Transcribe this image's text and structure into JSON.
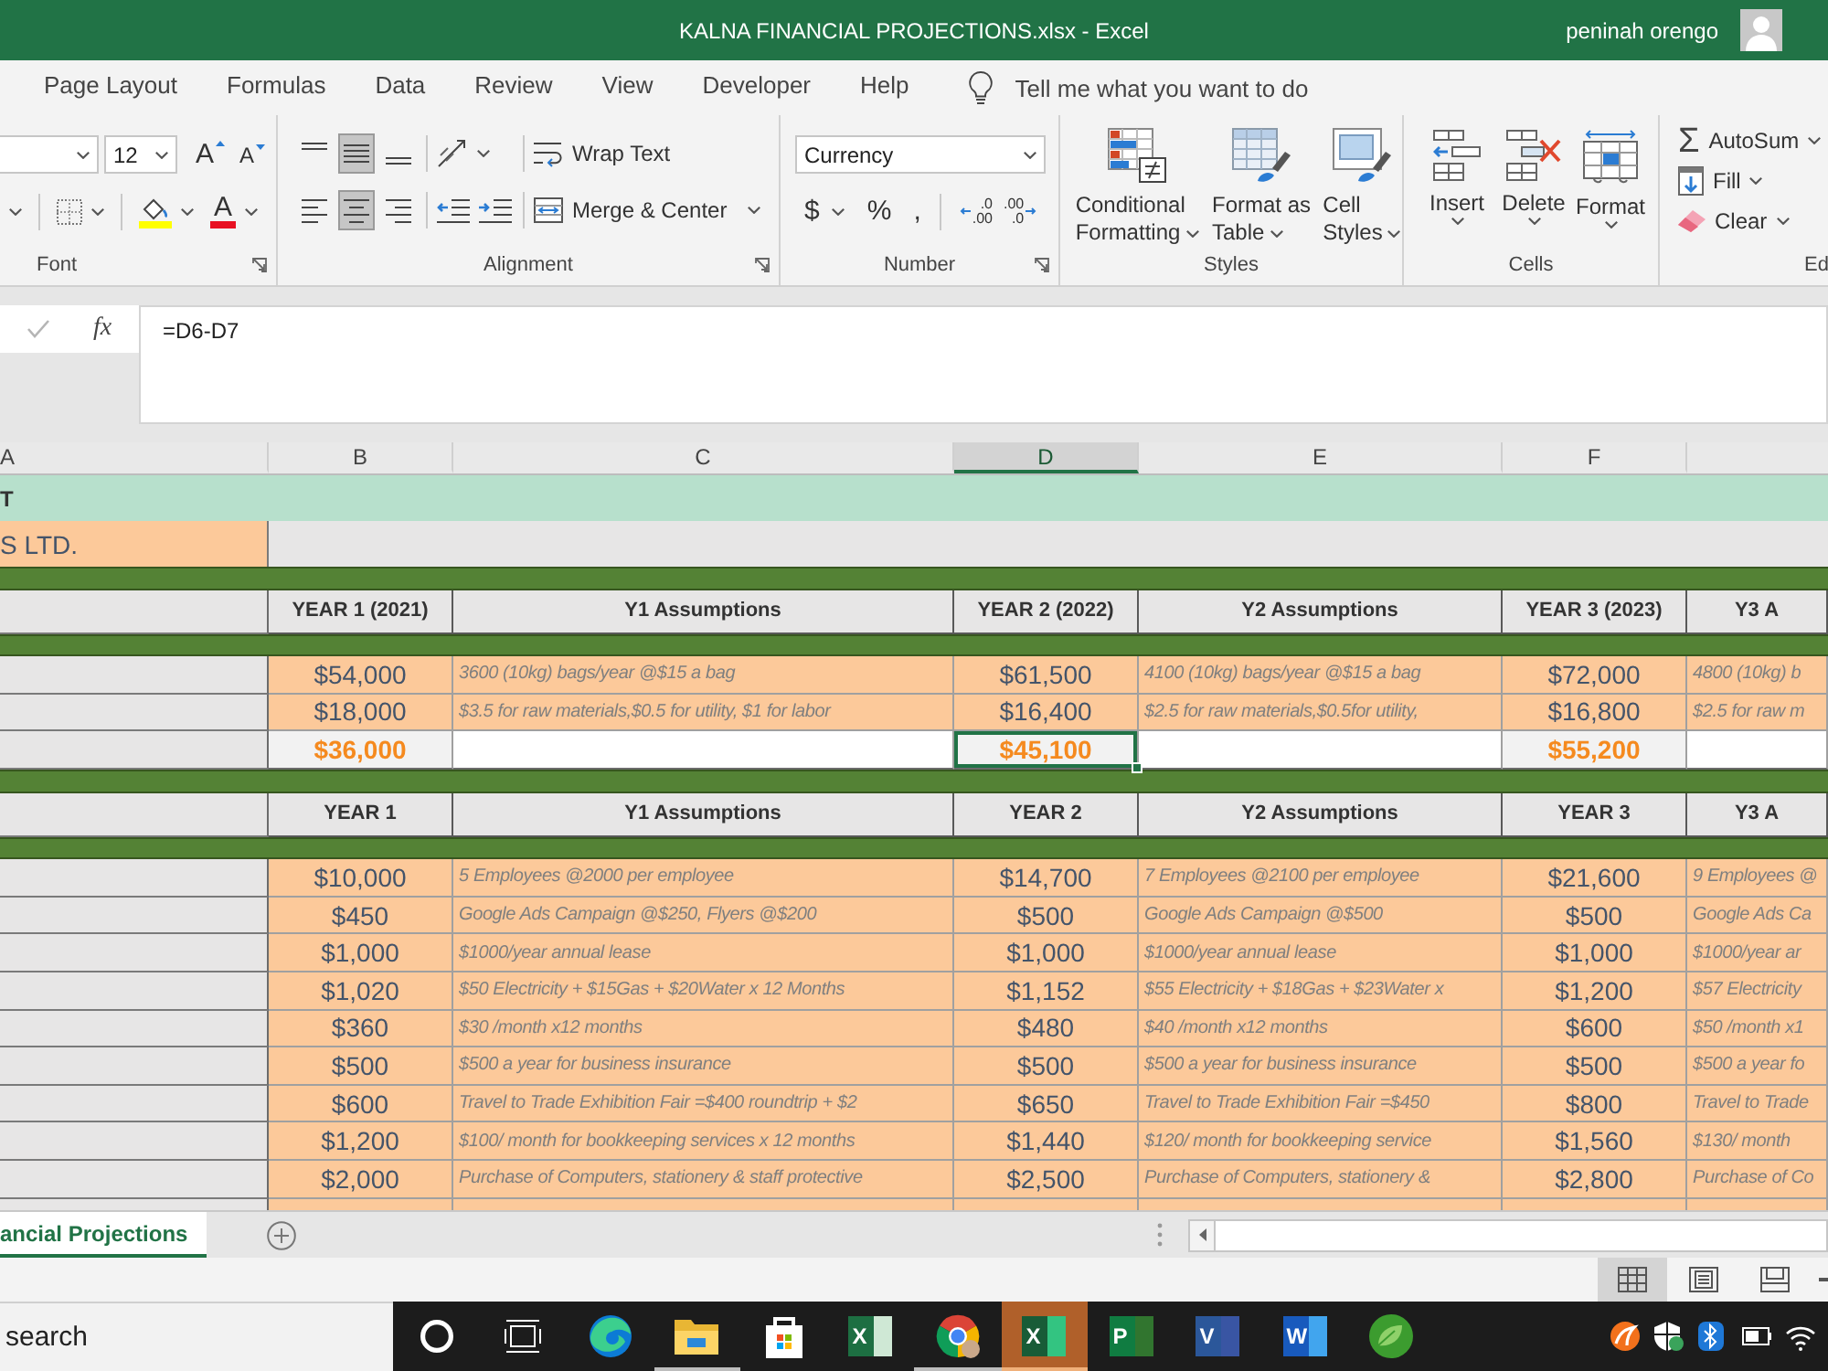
{
  "window": {
    "title": "KALNA FINANCIAL PROJECTIONS.xlsx - Excel",
    "user": "peninah orengo"
  },
  "menu": {
    "tabs": [
      {
        "label": "Page Layout",
        "selected": false
      },
      {
        "label": "Formulas",
        "selected": false
      },
      {
        "label": "Data",
        "selected": false
      },
      {
        "label": "Review",
        "selected": false
      },
      {
        "label": "View",
        "selected": false
      },
      {
        "label": "Developer",
        "selected": false
      },
      {
        "label": "Help",
        "selected": false
      }
    ],
    "tell_me": "Tell me what you want to do"
  },
  "ribbon": {
    "font": {
      "label": "Font",
      "size": "12",
      "grow": "A",
      "shrink": "A",
      "font_color": "A"
    },
    "alignment": {
      "label": "Alignment",
      "vertical": [
        {
          "kind": "top",
          "selected": false
        },
        {
          "kind": "middle",
          "selected": true
        },
        {
          "kind": "bottom",
          "selected": false
        }
      ],
      "horizontal": [
        {
          "kind": "left",
          "selected": false
        },
        {
          "kind": "center",
          "selected": true
        },
        {
          "kind": "right",
          "selected": false
        }
      ],
      "wrap_text": "Wrap Text",
      "merge": "Merge & Center"
    },
    "number": {
      "label": "Number",
      "format": "Currency",
      "symbols": [
        {
          "kind": "currency",
          "text": "$"
        },
        {
          "kind": "percent",
          "text": "%"
        },
        {
          "kind": "comma",
          "text": ","
        }
      ],
      "decimals": [
        {
          "kind": "increase",
          "lines": [
            ".0",
            ".00"
          ]
        },
        {
          "kind": "decrease",
          "lines": [
            ".00",
            ".0"
          ]
        }
      ]
    },
    "styles": {
      "label": "Styles",
      "buttons": [
        {
          "kind": "conditional",
          "lines": [
            "Conditional",
            "Formatting"
          ]
        },
        {
          "kind": "table",
          "lines": [
            "Format as",
            "Table"
          ]
        },
        {
          "kind": "cell",
          "lines": [
            "Cell",
            "Styles"
          ]
        }
      ]
    },
    "cells": {
      "label": "Cells",
      "buttons": [
        {
          "kind": "insert",
          "label": "Insert"
        },
        {
          "kind": "delete",
          "label": "Delete"
        },
        {
          "kind": "format",
          "label": "Format"
        }
      ]
    },
    "editing": {
      "label": "Ed",
      "buttons": [
        {
          "kind": "autosum",
          "symbol": "Σ",
          "label": "AutoSum"
        },
        {
          "kind": "fill",
          "label": "Fill"
        },
        {
          "kind": "clear",
          "label": "Clear"
        }
      ]
    }
  },
  "formula_bar": {
    "function_label": "fx",
    "formula": "=D6-D7"
  },
  "sheet": {
    "columns": [
      {
        "label": "A",
        "selected": false
      },
      {
        "label": "B",
        "selected": false
      },
      {
        "label": "C",
        "selected": false
      },
      {
        "label": "D",
        "selected": true
      },
      {
        "label": "E",
        "selected": false
      },
      {
        "label": "F",
        "selected": false
      }
    ],
    "rows": [
      {
        "kind": "title",
        "text": "T"
      },
      {
        "kind": "company",
        "text": "S LTD."
      },
      {
        "kind": "band"
      },
      {
        "kind": "header",
        "years": [
          {
            "amount": "YEAR 1 (2021)",
            "note": "Y1 Assumptions"
          },
          {
            "amount": "YEAR 2 (2022)",
            "note": "Y2 Assumptions"
          },
          {
            "amount": "YEAR 3 (2023)",
            "note": "Y3 A"
          }
        ]
      },
      {
        "kind": "band"
      },
      {
        "kind": "value",
        "years": [
          {
            "amount": "$54,000",
            "note": "3600 (10kg) bags/year @$15 a bag",
            "selected": false
          },
          {
            "amount": "$61,500",
            "note": "4100 (10kg) bags/year @$15 a bag",
            "selected": false
          },
          {
            "amount": "$72,000",
            "note": "4800 (10kg) b",
            "selected": false
          }
        ]
      },
      {
        "kind": "value",
        "years": [
          {
            "amount": "$18,000",
            "note": "$3.5 for raw materials,$0.5 for utility, $1 for labor",
            "selected": false
          },
          {
            "amount": "$16,400",
            "note": "$2.5 for raw materials,$0.5for utility,",
            "selected": false
          },
          {
            "amount": "$16,800",
            "note": "$2.5 for raw m",
            "selected": false
          }
        ]
      },
      {
        "kind": "total",
        "years": [
          {
            "amount": "$36,000",
            "selected": false
          },
          {
            "amount": "$45,100",
            "selected": true
          },
          {
            "amount": "$55,200",
            "selected": false
          }
        ]
      },
      {
        "kind": "band"
      },
      {
        "kind": "header",
        "years": [
          {
            "amount": "YEAR 1",
            "note": "Y1 Assumptions"
          },
          {
            "amount": "YEAR 2",
            "note": "Y2 Assumptions"
          },
          {
            "amount": "YEAR 3",
            "note": "Y3 A"
          }
        ]
      },
      {
        "kind": "band"
      },
      {
        "kind": "value",
        "years": [
          {
            "amount": "$10,000",
            "note": "5 Employees @2000 per employee",
            "selected": false
          },
          {
            "amount": "$14,700",
            "note": "7 Employees @2100 per employee",
            "selected": false
          },
          {
            "amount": "$21,600",
            "note": "9 Employees @",
            "selected": false
          }
        ]
      },
      {
        "kind": "value",
        "years": [
          {
            "amount": "$450",
            "note": "Google Ads Campaign @$250, Flyers @$200",
            "selected": false
          },
          {
            "amount": "$500",
            "note": "Google Ads Campaign @$500",
            "selected": false
          },
          {
            "amount": "$500",
            "note": "Google Ads Ca",
            "selected": false
          }
        ]
      },
      {
        "kind": "value",
        "years": [
          {
            "amount": "$1,000",
            "note": "$1000/year annual lease",
            "selected": false
          },
          {
            "amount": "$1,000",
            "note": "$1000/year annual lease",
            "selected": false
          },
          {
            "amount": "$1,000",
            "note": "$1000/year ar",
            "selected": false
          }
        ]
      },
      {
        "kind": "value",
        "years": [
          {
            "amount": "$1,020",
            "note": "$50 Electricity + $15Gas + $20Water x 12 Months",
            "selected": false
          },
          {
            "amount": "$1,152",
            "note": "$55 Electricity + $18Gas + $23Water x",
            "selected": false
          },
          {
            "amount": "$1,200",
            "note": "$57 Electricity",
            "selected": false
          }
        ]
      },
      {
        "kind": "value",
        "years": [
          {
            "amount": "$360",
            "note": "$30 /month x12 months",
            "selected": false
          },
          {
            "amount": "$480",
            "note": "$40 /month x12 months",
            "selected": false
          },
          {
            "amount": "$600",
            "note": "$50 /month x1",
            "selected": false
          }
        ]
      },
      {
        "kind": "value",
        "years": [
          {
            "amount": "$500",
            "note": "$500 a year for business insurance",
            "selected": false
          },
          {
            "amount": "$500",
            "note": "$500 a year for business insurance",
            "selected": false
          },
          {
            "amount": "$500",
            "note": "$500 a year fo",
            "selected": false
          }
        ]
      },
      {
        "kind": "value",
        "years": [
          {
            "amount": "$600",
            "note": "Travel to Trade Exhibition Fair =$400 roundtrip + $2",
            "selected": false
          },
          {
            "amount": "$650",
            "note": "Travel to Trade Exhibition Fair =$450",
            "selected": false
          },
          {
            "amount": "$800",
            "note": "Travel to Trade",
            "selected": false
          }
        ]
      },
      {
        "kind": "value",
        "years": [
          {
            "amount": "$1,200",
            "note": "$100/ month for bookkeeping services x 12 months",
            "selected": false
          },
          {
            "amount": "$1,440",
            "note": "$120/ month for bookkeeping service",
            "selected": false
          },
          {
            "amount": "$1,560",
            "note": "$130/ month",
            "selected": false
          }
        ]
      },
      {
        "kind": "value",
        "years": [
          {
            "amount": "$2,000",
            "note": "Purchase of Computers, stationery & staff protective",
            "selected": false
          },
          {
            "amount": "$2,500",
            "note": "Purchase of Computers, stationery &",
            "selected": false
          },
          {
            "amount": "$2,800",
            "note": "Purchase of Co",
            "selected": false
          }
        ]
      },
      {
        "kind": "cut"
      }
    ]
  },
  "sheet_tabs": [
    {
      "label": "ancial Projections",
      "selected": true
    }
  ],
  "status_bar": {
    "views": [
      {
        "kind": "normal",
        "selected": true
      },
      {
        "kind": "page_layout",
        "selected": false
      },
      {
        "kind": "page_break",
        "selected": false
      }
    ]
  },
  "taskbar": {
    "search": {
      "placeholder": "search"
    },
    "apps": [
      {
        "kind": "edge",
        "running": false,
        "selected": false
      },
      {
        "kind": "explorer",
        "running": true,
        "selected": false
      },
      {
        "kind": "store",
        "running": false,
        "selected": false
      },
      {
        "kind": "excel_legacy",
        "letter": "X",
        "running": false,
        "selected": false
      },
      {
        "kind": "chrome",
        "running": true,
        "selected": false
      },
      {
        "kind": "excel",
        "letter": "X",
        "running": true,
        "selected": true
      },
      {
        "kind": "project",
        "letter": "P",
        "running": false,
        "selected": false
      },
      {
        "kind": "visio",
        "letter": "V",
        "running": false,
        "selected": false
      },
      {
        "kind": "word",
        "letter": "W",
        "running": false,
        "selected": false
      },
      {
        "kind": "leaf",
        "running": false,
        "selected": false
      }
    ]
  }
}
